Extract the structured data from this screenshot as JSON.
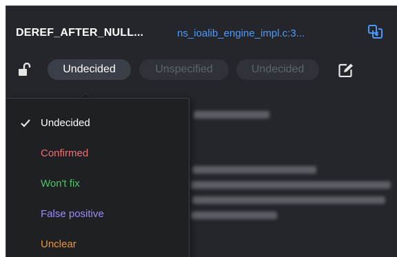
{
  "header": {
    "checker_name": "DEREF_AFTER_NULL...",
    "file_name": "ns_ioalib_engine_impl.c:3...",
    "copy_icon": "copy-link-icon",
    "lock_icon": "unlocked-padlock-icon",
    "edit_icon": "edit-square-icon"
  },
  "triage": {
    "status": "Undecided",
    "severity": "Unspecified",
    "action": "Undecided"
  },
  "status_menu": {
    "selected_index": 0,
    "items": [
      {
        "label": "Undecided",
        "color": "#ffffff"
      },
      {
        "label": "Confirmed",
        "color": "#f07070"
      },
      {
        "label": "Won't fix",
        "color": "#52c463"
      },
      {
        "label": "False positive",
        "color": "#9b8cff"
      },
      {
        "label": "Unclear",
        "color": "#f0962e"
      }
    ]
  },
  "colors": {
    "panel_bg": "#24262b",
    "link": "#4a9bff",
    "pill_active_bg": "#3b3f47",
    "pill_inactive_text": "#60646c"
  }
}
